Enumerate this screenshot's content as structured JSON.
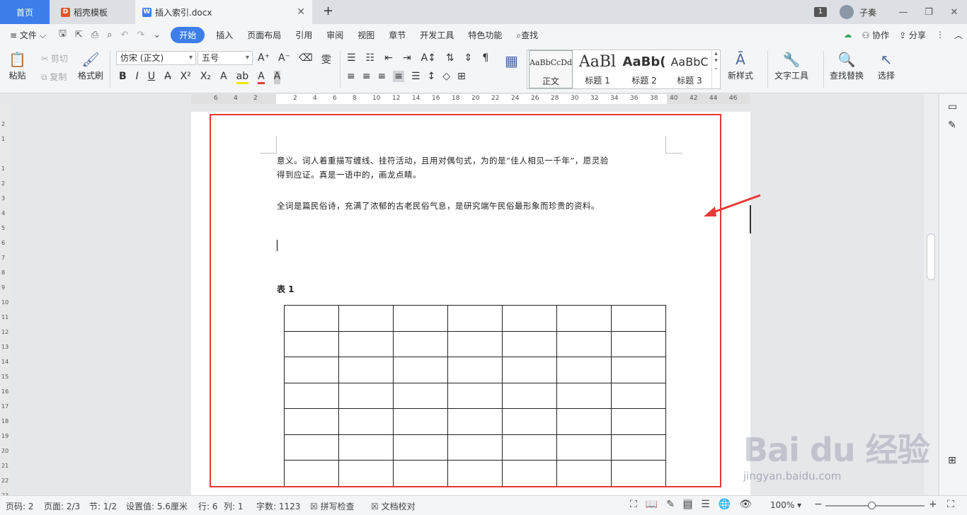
{
  "tabs": {
    "home": "首页",
    "template": "稻壳模板",
    "doc": "插入索引.docx",
    "add": "+",
    "close": "✕"
  },
  "user": {
    "badge": "1",
    "name": "子奏",
    "min": "—",
    "restore": "❐",
    "close": "✕"
  },
  "menu": {
    "file": "文件",
    "items": [
      "开始",
      "插入",
      "页面布局",
      "引用",
      "审阅",
      "视图",
      "章节",
      "开发工具",
      "特色功能"
    ],
    "search": "查找",
    "sync": "☁",
    "collab": "协作",
    "share": "分享",
    "more": "⋮",
    "collapse": "︿"
  },
  "ribbon": {
    "paste": "粘贴",
    "cut": "剪切",
    "copy": "复制",
    "format_painter": "格式刷",
    "font_name": "仿宋 (正文)",
    "font_size": "五号",
    "styles": [
      {
        "preview": "AaBbCcDd",
        "label": "正文"
      },
      {
        "preview": "AaBl",
        "label": "标题 1"
      },
      {
        "preview": "AaBb(",
        "label": "标题 2"
      },
      {
        "preview": "AaBbC",
        "label": "标题 3"
      }
    ],
    "new_style": "新样式",
    "text_tools": "文字工具",
    "find_replace": "查找替换",
    "select": "选择"
  },
  "ruler": {
    "h_ticks": [
      "6",
      "4",
      "2",
      "",
      "2",
      "4",
      "6",
      "8",
      "10",
      "12",
      "14",
      "16",
      "18",
      "20",
      "22",
      "24",
      "26",
      "28",
      "30",
      "32",
      "34",
      "36",
      "38",
      "40",
      "42",
      "44",
      "46"
    ],
    "v_ticks": [
      "2",
      "1",
      "",
      "1",
      "2",
      "3",
      "4",
      "5",
      "6",
      "7",
      "8",
      "9",
      "10",
      "11",
      "12",
      "13",
      "14",
      "15",
      "16",
      "17",
      "18",
      "19",
      "20",
      "21",
      "22",
      "23"
    ]
  },
  "document": {
    "line1": "意义。词人着重描写缠线、挂符活动，且用对偶句式，为的是“佳人相见一千年”，愿灵验",
    "line2": "得到应证。真是一语中的，画龙点睛。",
    "line3": "全词是篇民俗诗，充满了浓郁的古老民俗气息，是研究端午民俗最形象而珍贵的资料。",
    "caption": "表 1",
    "table_rows": 7,
    "table_cols": 7
  },
  "status": {
    "page_num": "页码: 2",
    "page": "页面: 2/3",
    "section": "节: 1/2",
    "setting": "设置值: 5.6厘米",
    "row": "行: 6",
    "col": "列: 1",
    "words": "字数: 1123",
    "spell": "拼写检查",
    "proof": "文档校对",
    "zoom": "100%",
    "zoom_minus": "−",
    "zoom_plus": "+"
  },
  "watermark": {
    "logo": "Bai du 经验",
    "url": "jingyan.baidu.com"
  },
  "colors": {
    "accent": "#3d7eea",
    "highlight": "#e53935"
  }
}
